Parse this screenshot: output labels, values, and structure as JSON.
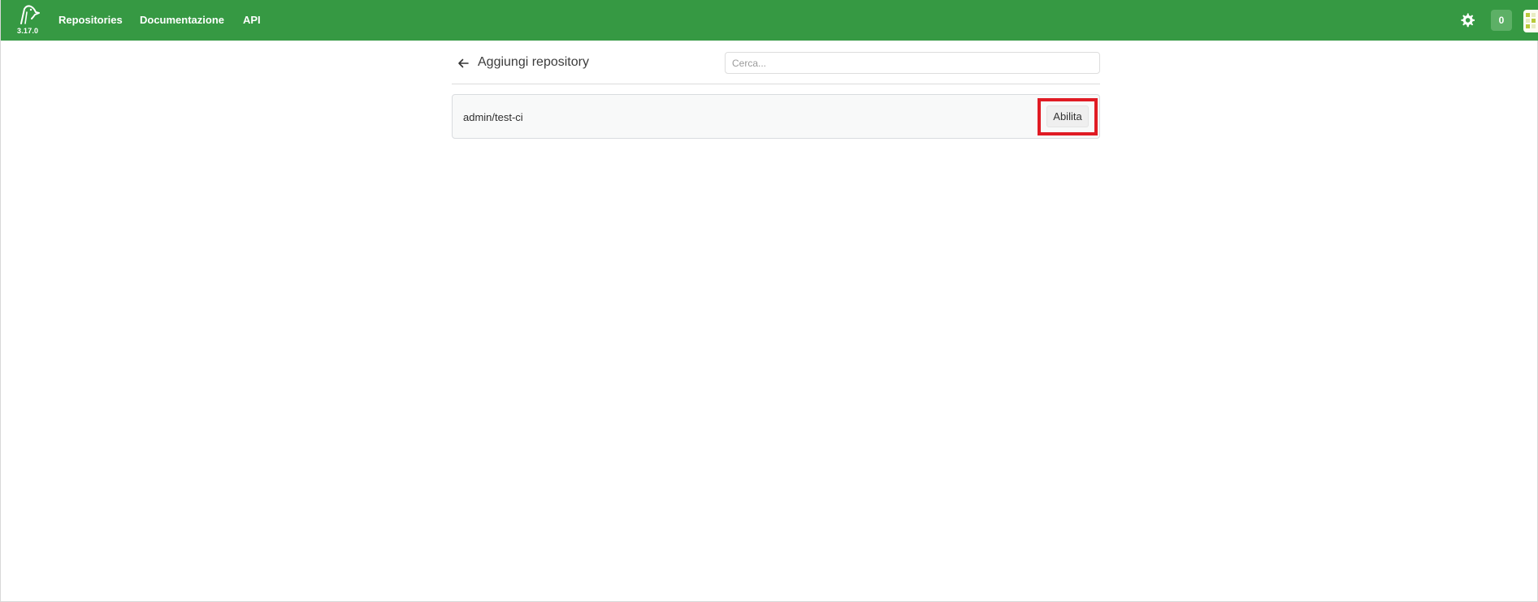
{
  "app": {
    "version": "3.17.0"
  },
  "nav": {
    "items": [
      {
        "label": "Repositories"
      },
      {
        "label": "Documentazione"
      },
      {
        "label": "API"
      }
    ],
    "settings_icon": "gear-icon",
    "counter": "0",
    "avatar_icon": "avatar-icon"
  },
  "page": {
    "back_icon": "arrow-left-icon",
    "title": "Aggiungi repository",
    "search": {
      "placeholder": "Cerca...",
      "value": ""
    }
  },
  "repositories": [
    {
      "name": "admin/test-ci",
      "action_label": "Abilita"
    }
  ],
  "colors": {
    "brand": "#369943",
    "highlight": "#e01b24"
  }
}
